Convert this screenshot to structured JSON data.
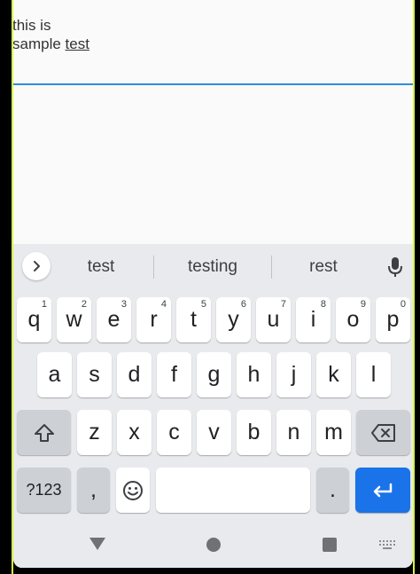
{
  "editor": {
    "line1": "this is",
    "line2_prefix": "sample ",
    "line2_current_word": "test"
  },
  "suggestions": [
    "test",
    "testing",
    "rest"
  ],
  "keyboard": {
    "row1": [
      {
        "key": "q",
        "hint": "1"
      },
      {
        "key": "w",
        "hint": "2"
      },
      {
        "key": "e",
        "hint": "3"
      },
      {
        "key": "r",
        "hint": "4"
      },
      {
        "key": "t",
        "hint": "5"
      },
      {
        "key": "y",
        "hint": "6"
      },
      {
        "key": "u",
        "hint": "7"
      },
      {
        "key": "i",
        "hint": "8"
      },
      {
        "key": "o",
        "hint": "9"
      },
      {
        "key": "p",
        "hint": "0"
      }
    ],
    "row2": [
      "a",
      "s",
      "d",
      "f",
      "g",
      "h",
      "j",
      "k",
      "l"
    ],
    "row3": [
      "z",
      "x",
      "c",
      "v",
      "b",
      "n",
      "m"
    ],
    "symbols_label": "?123",
    "comma_label": ",",
    "period_label": ".",
    "colors": {
      "key": "#ffffff",
      "function_key": "#cdd0d5",
      "enter_key": "#1a73e8",
      "background": "#e8eaed",
      "text_field_underline": "#2d8ee0"
    }
  },
  "icons": {
    "expand": "chevron-right-icon",
    "mic": "mic-icon",
    "shift": "shift-icon",
    "backspace": "backspace-icon",
    "emoji": "emoji-icon",
    "enter": "enter-icon",
    "nav_back": "back-triangle-icon",
    "nav_home": "home-circle-icon",
    "nav_recents": "recents-square-icon",
    "nav_keyboard": "keyboard-switch-icon"
  }
}
